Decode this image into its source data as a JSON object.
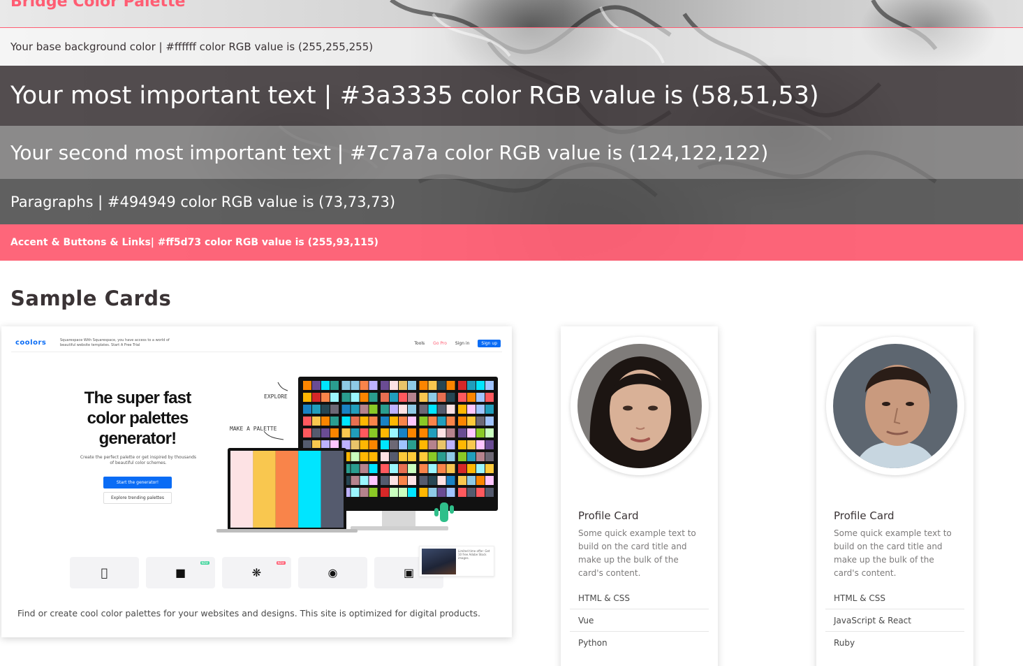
{
  "hero": {
    "brand": "Bridge Color Palette",
    "base_text": "Your base background color | #ffffff color RGB value is (255,255,255)",
    "important_text": "Your most important text | #3a3335 color RGB value is (58,51,53)",
    "second_text": "Your second most important text | #7c7a7a color RGB value is (124,122,122)",
    "paragraph_text": "Paragraphs | #494949 color RGB value is (73,73,73)",
    "accent_text": "Accent & Buttons & Links| #ff5d73 color RGB value is (255,93,115)"
  },
  "colors": {
    "base": "#ffffff",
    "important": "#3a3335",
    "second": "#7c7a7a",
    "paragraph": "#494949",
    "accent": "#ff5d73"
  },
  "samples": {
    "title": "Sample Cards",
    "screenshot_card": {
      "caption": "Find or create cool color palettes for your websites and designs. This site is optimized for digital products.",
      "site": {
        "logo": "coolors",
        "promo": "Squarespace With Squarespace, you have access to a world of beautiful website templates. Start A Free Trial",
        "nav": [
          "Tools",
          "Go Pro",
          "Sign in",
          "Sign up"
        ],
        "headline": "The super fast color palettes generator!",
        "subtext": "Create the perfect palette or get inspired by thousands of beautiful color schemes.",
        "primary_button": "Start the generator!",
        "secondary_button": "Explore trending palettes",
        "note_explore": "EXPLORE",
        "note_make": "MAKE A PALETTE",
        "badge_new": "NEW",
        "ad_text": "Limited time offer: Get 10 free Adobe Stock images.",
        "palette": [
          "#fde2e4",
          "#f9c74f",
          "#f9844a",
          "#00e5ff",
          "#555b6e"
        ]
      }
    },
    "profile_cards": [
      {
        "title": "Profile Card",
        "text": "Some quick example text to build on the card title and make up the bulk of the card's content.",
        "items": [
          "HTML & CSS",
          "Vue",
          "Python"
        ]
      },
      {
        "title": "Profile Card",
        "text": "Some quick example text to build on the card title and make up the bulk of the card's content.",
        "items": [
          "HTML & CSS",
          "JavaScript & React",
          "Ruby"
        ]
      }
    ]
  }
}
